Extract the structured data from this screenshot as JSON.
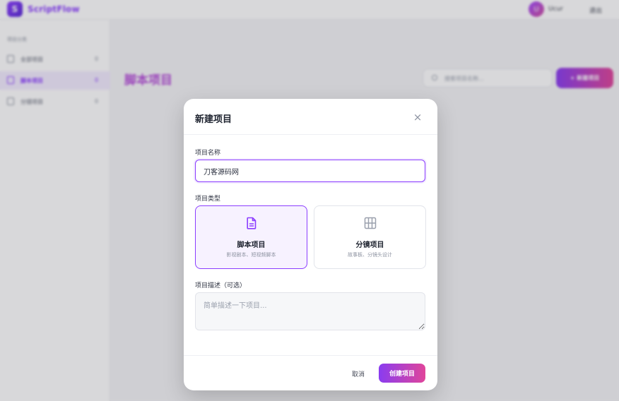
{
  "app": {
    "logo_mark": "S",
    "name": "ScriptFlow",
    "user_avatar": "U",
    "username": "Ucur",
    "logout_label": "退出"
  },
  "sidebar": {
    "heading": "项目分类",
    "items": [
      {
        "label": "全部项目",
        "count": "0",
        "icon": "grid-icon"
      },
      {
        "label": "脚本项目",
        "count": "0",
        "icon": "document-icon",
        "active": true
      },
      {
        "label": "分镜项目",
        "count": "0",
        "icon": "storyboard-icon"
      }
    ]
  },
  "main": {
    "title": "脚本项目",
    "search_placeholder": "搜索项目名称...",
    "new_button_label": "+ 新建项目"
  },
  "modal": {
    "title": "新建项目",
    "close_label": "×",
    "name_label": "项目名称",
    "name_value": "刀客源码网",
    "type_label": "项目类型",
    "types": [
      {
        "title": "脚本项目",
        "desc": "影视剧本、短视频脚本",
        "icon": "document-icon",
        "selected": true
      },
      {
        "title": "分镜项目",
        "desc": "故事板、分镜头设计",
        "icon": "storyboard-grid-icon",
        "selected": false
      }
    ],
    "desc_label": "项目描述（可选）",
    "desc_placeholder": "简单描述一下项目...",
    "desc_value": "",
    "cancel_label": "取消",
    "create_label": "创建项目"
  },
  "colors": {
    "accent": "#8b3dff",
    "accent_gradient_end": "#e0459a",
    "selected_card_bg": "#f7f2ff"
  }
}
